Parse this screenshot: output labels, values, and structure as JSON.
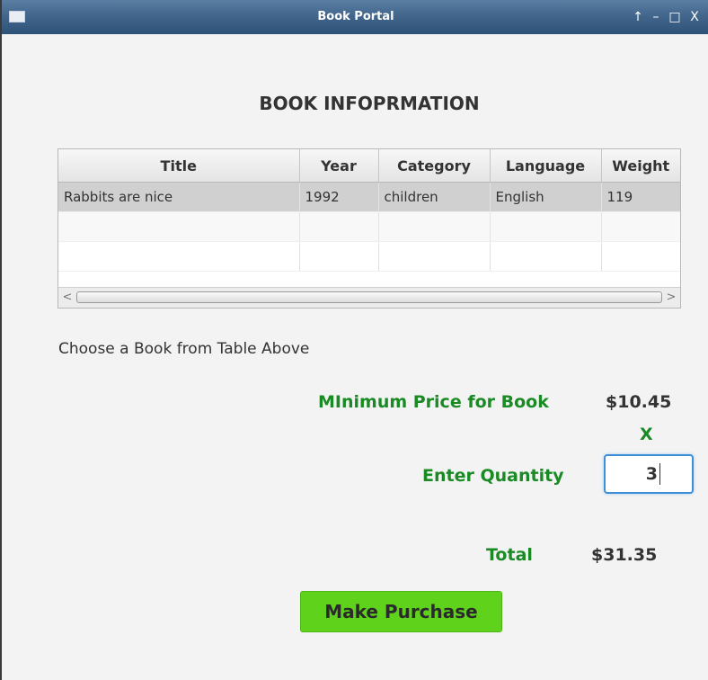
{
  "window": {
    "title": "Book Portal",
    "controls": {
      "up": "↑",
      "minimize": "–",
      "maximize": "□",
      "close": "X"
    }
  },
  "heading": "BOOK INFOPRMATION",
  "table": {
    "columns": [
      "Title",
      "Year",
      "Category",
      "Language",
      "Weight"
    ],
    "rows": [
      {
        "title": "Rabbits are nice",
        "year": "1992",
        "category": "children",
        "language": "English",
        "weight": "119"
      }
    ]
  },
  "scrollbar": {
    "left_arrow": "<",
    "right_arrow": ">"
  },
  "hint": "Choose a Book from Table Above",
  "price": {
    "label": "MInimum Price for Book",
    "value": "$10.45"
  },
  "multiply_sign": "X",
  "quantity": {
    "label": "Enter Quantity",
    "value": "3"
  },
  "total": {
    "label": "Total",
    "value": "$31.35"
  },
  "purchase_button": "Make Purchase",
  "colors": {
    "label_green": "#1a8a24",
    "button_green": "#5fd31c",
    "focus_blue": "#3d8fd6"
  }
}
